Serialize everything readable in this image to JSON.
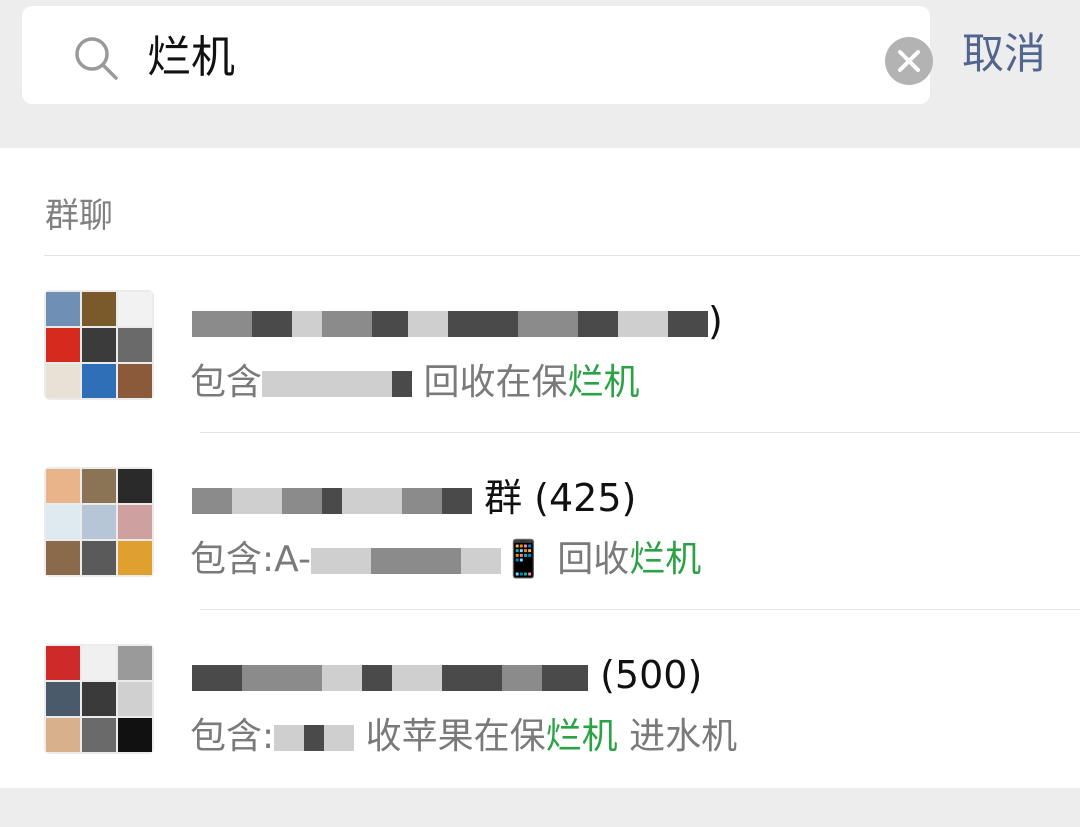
{
  "search": {
    "query": "烂机",
    "cancel_label": "取消"
  },
  "results": {
    "section_title": "群聊",
    "highlight_color": "#2ba245",
    "groups": [
      {
        "name_visible": ")",
        "desc_prefix": "包含",
        "desc_middle": "回收在保",
        "desc_highlight": "烂机",
        "desc_suffix": ""
      },
      {
        "name_visible": "群 (425)",
        "desc_prefix": "包含:A-",
        "desc_icon": "📱",
        "desc_middle": "回收",
        "desc_highlight": "烂机",
        "desc_suffix": ""
      },
      {
        "name_visible": "(500)",
        "desc_prefix": "包含:",
        "desc_middle": "收苹果在保",
        "desc_highlight": "烂机",
        "desc_suffix": "进水机"
      }
    ]
  }
}
